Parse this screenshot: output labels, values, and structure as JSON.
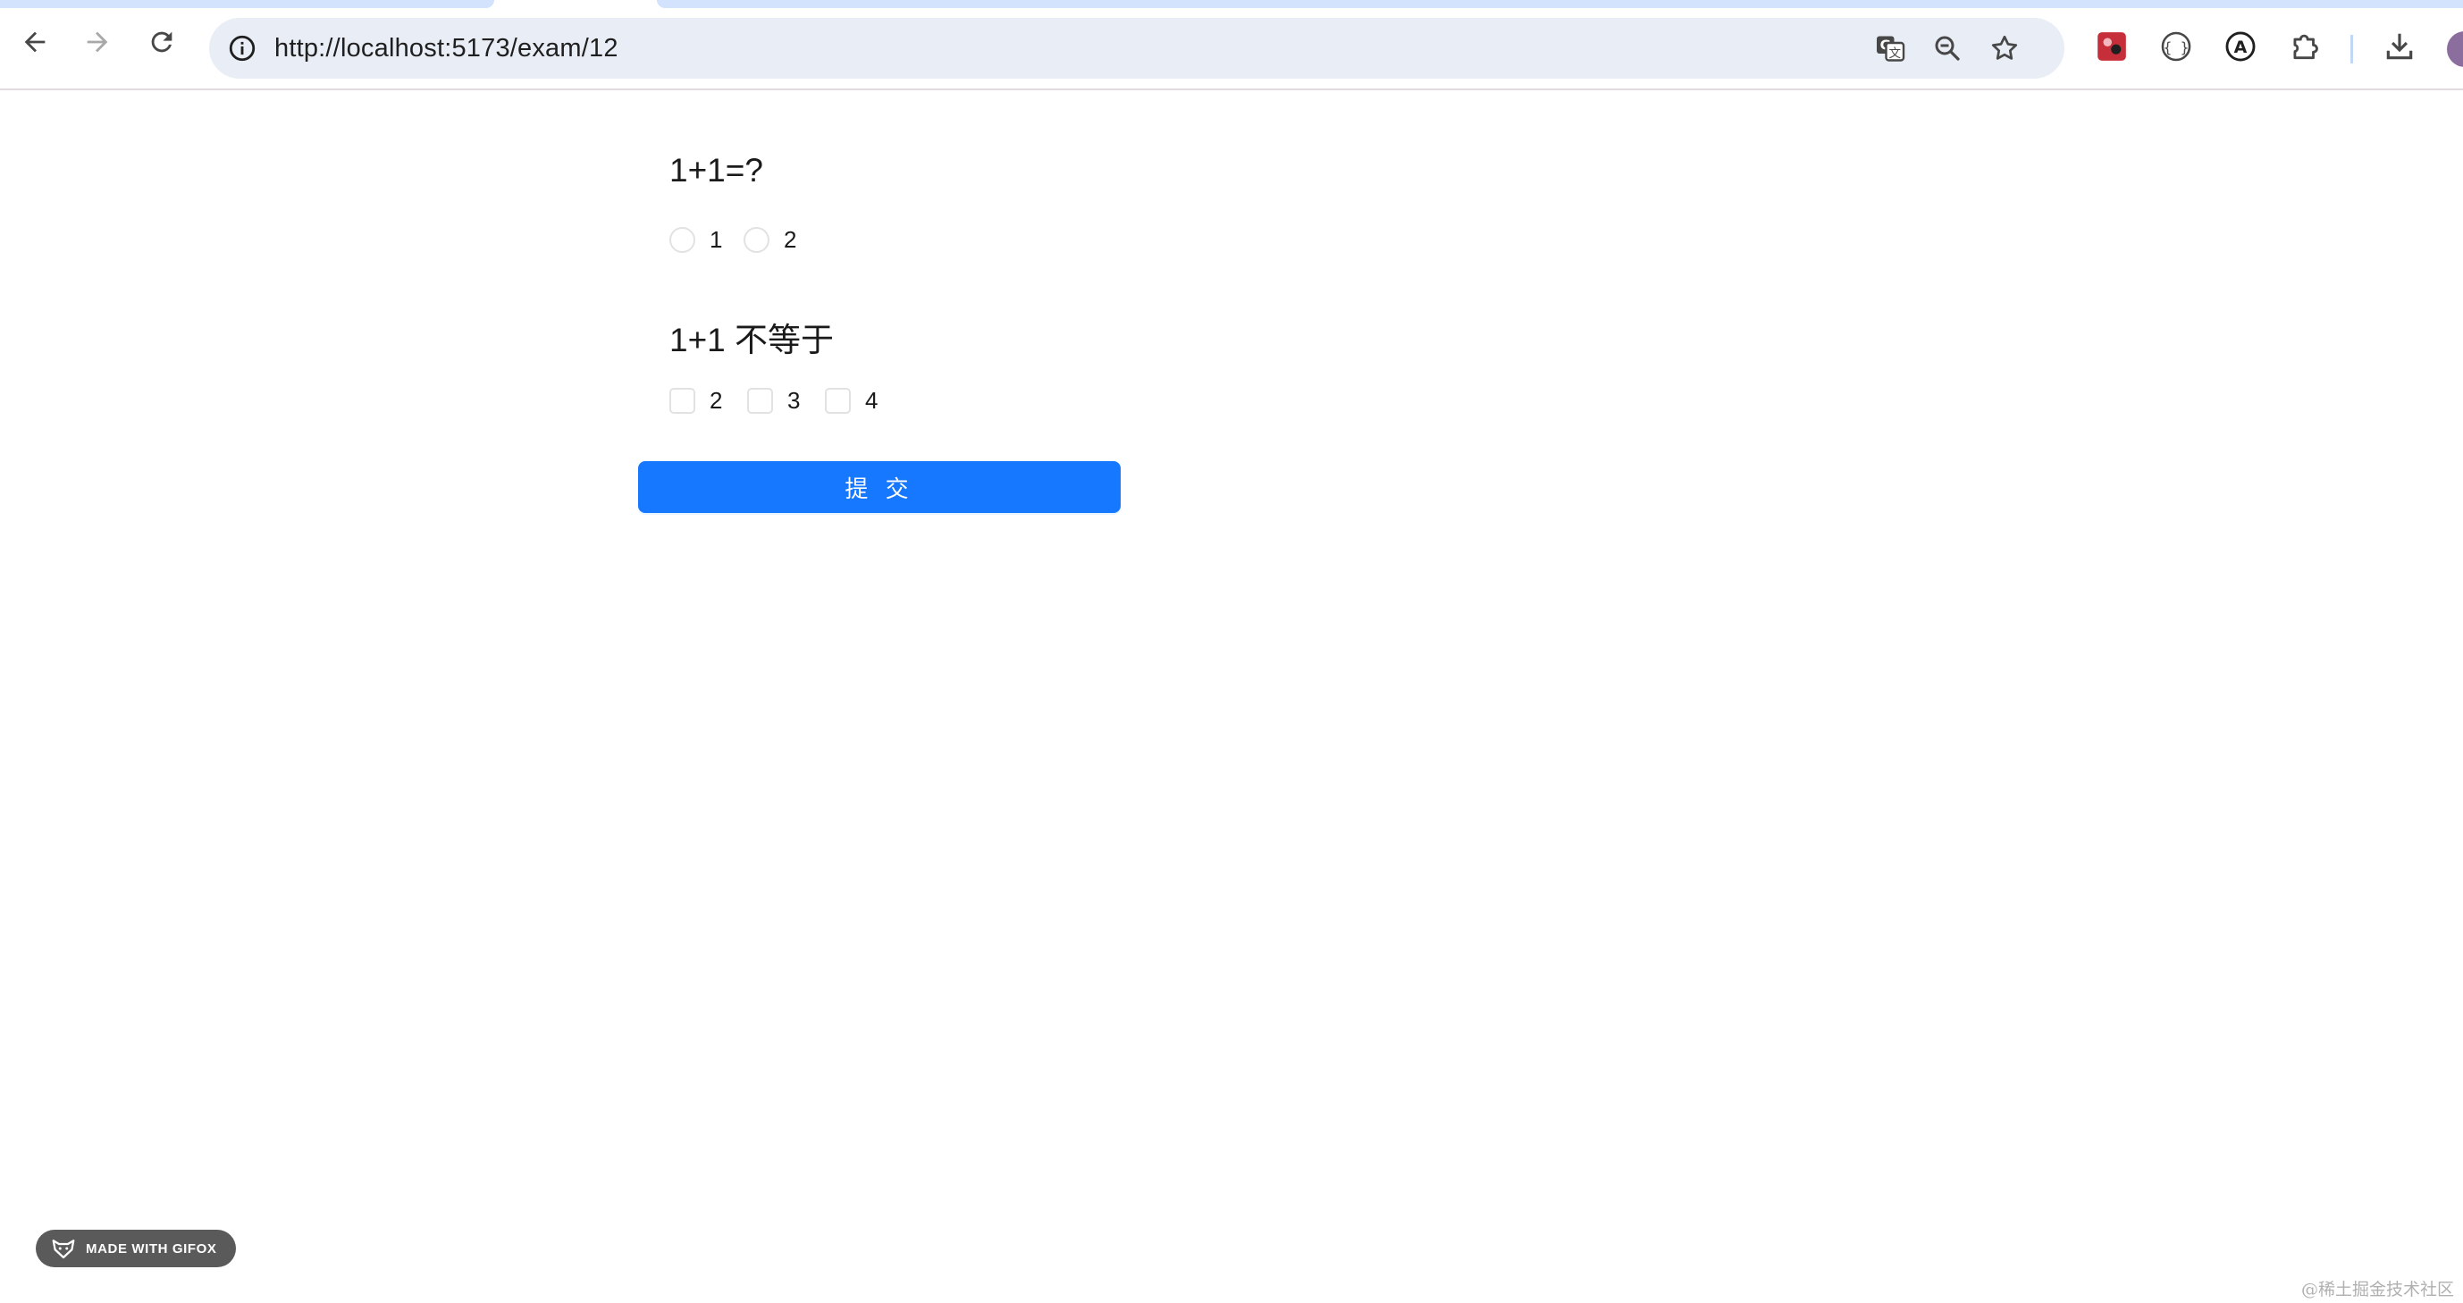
{
  "browser": {
    "url": "http://localhost:5173/exam/12",
    "icons": {
      "back": "arrow-left-icon",
      "forward": "arrow-right-icon",
      "reload": "reload-icon",
      "info": "info-icon",
      "translate": "translate-icon",
      "zoom": "zoom-out-icon",
      "bookmark": "star-icon",
      "extensions": [
        "red-extension-icon",
        "braces-extension-icon",
        "a-circle-extension-icon",
        "puzzle-icon"
      ],
      "download": "download-icon"
    },
    "colors": {
      "omnibox_bg": "#e9eef6",
      "tab_bg": "#d3e3fd"
    }
  },
  "exam": {
    "questions": [
      {
        "type": "radio",
        "title": "1+1=?",
        "options": [
          "1",
          "2"
        ]
      },
      {
        "type": "checkbox",
        "title": "1+1 不等于",
        "options": [
          "2",
          "3",
          "4"
        ]
      }
    ],
    "submit_label": "提 交",
    "colors": {
      "primary": "#1677ff"
    }
  },
  "overlays": {
    "gifox_badge": "MADE WITH GIFOX",
    "watermark": "@稀土掘金技术社区"
  }
}
